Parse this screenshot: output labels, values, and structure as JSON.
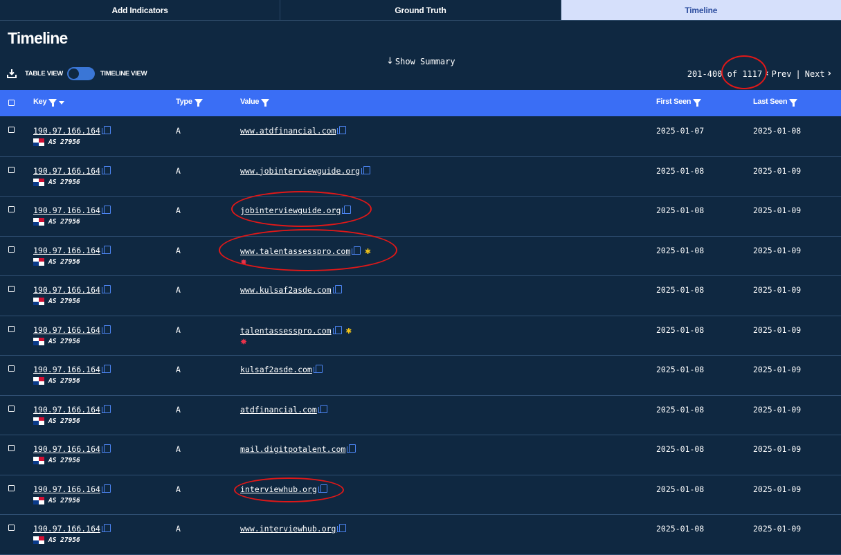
{
  "tabs": [
    {
      "label": "Add Indicators",
      "active": false
    },
    {
      "label": "Ground Truth",
      "active": false
    },
    {
      "label": "Timeline",
      "active": true
    }
  ],
  "page_title": "Timeline",
  "show_summary_label": "Show Summary",
  "view_toggle": {
    "table_label": "TABLE VIEW",
    "timeline_label": "TIMELINE VIEW",
    "selected": "TABLE VIEW"
  },
  "pager": {
    "range": "201-400",
    "of_label": "of",
    "total": "1117",
    "prev": "Prev",
    "separator": "|",
    "next": "Next"
  },
  "columns": {
    "key": "Key",
    "type": "Type",
    "value": "Value",
    "first_seen": "First Seen",
    "last_seen": "Last Seen"
  },
  "rows": [
    {
      "key": "190.97.166.164",
      "asn": "AS 27956",
      "type": "A",
      "value": "www.atdfinancial.com",
      "first_seen": "2025-01-07",
      "last_seen": "2025-01-08",
      "star": "",
      "badge": ""
    },
    {
      "key": "190.97.166.164",
      "asn": "AS 27956",
      "type": "A",
      "value": "www.jobinterviewguide.org",
      "first_seen": "2025-01-08",
      "last_seen": "2025-01-09",
      "star": "",
      "badge": ""
    },
    {
      "key": "190.97.166.164",
      "asn": "AS 27956",
      "type": "A",
      "value": "jobinterviewguide.org",
      "first_seen": "2025-01-08",
      "last_seen": "2025-01-09",
      "star": "",
      "badge": ""
    },
    {
      "key": "190.97.166.164",
      "asn": "AS 27956",
      "type": "A",
      "value": "www.talentassesspro.com",
      "first_seen": "2025-01-08",
      "last_seen": "2025-01-09",
      "star": "✱",
      "badge": "✸"
    },
    {
      "key": "190.97.166.164",
      "asn": "AS 27956",
      "type": "A",
      "value": "www.kulsaf2asde.com",
      "first_seen": "2025-01-08",
      "last_seen": "2025-01-09",
      "star": "",
      "badge": ""
    },
    {
      "key": "190.97.166.164",
      "asn": "AS 27956",
      "type": "A",
      "value": "talentassesspro.com",
      "first_seen": "2025-01-08",
      "last_seen": "2025-01-09",
      "star": "✱",
      "badge": "✸"
    },
    {
      "key": "190.97.166.164",
      "asn": "AS 27956",
      "type": "A",
      "value": "kulsaf2asde.com",
      "first_seen": "2025-01-08",
      "last_seen": "2025-01-09",
      "star": "",
      "badge": ""
    },
    {
      "key": "190.97.166.164",
      "asn": "AS 27956",
      "type": "A",
      "value": "atdfinancial.com",
      "first_seen": "2025-01-08",
      "last_seen": "2025-01-09",
      "star": "",
      "badge": ""
    },
    {
      "key": "190.97.166.164",
      "asn": "AS 27956",
      "type": "A",
      "value": "mail.digitpotalent.com",
      "first_seen": "2025-01-08",
      "last_seen": "2025-01-09",
      "star": "",
      "badge": ""
    },
    {
      "key": "190.97.166.164",
      "asn": "AS 27956",
      "type": "A",
      "value": "interviewhub.org",
      "first_seen": "2025-01-08",
      "last_seen": "2025-01-09",
      "star": "",
      "badge": ""
    },
    {
      "key": "190.97.166.164",
      "asn": "AS 27956",
      "type": "A",
      "value": "www.interviewhub.org",
      "first_seen": "2025-01-08",
      "last_seen": "2025-01-09",
      "star": "",
      "badge": ""
    }
  ],
  "colors": {
    "background": "#0f2841",
    "header_bar": "#3a6ef5",
    "active_tab": "#d6e0fb",
    "annotation": "#e01818",
    "star": "#f5c518",
    "badge": "#e8334a"
  }
}
